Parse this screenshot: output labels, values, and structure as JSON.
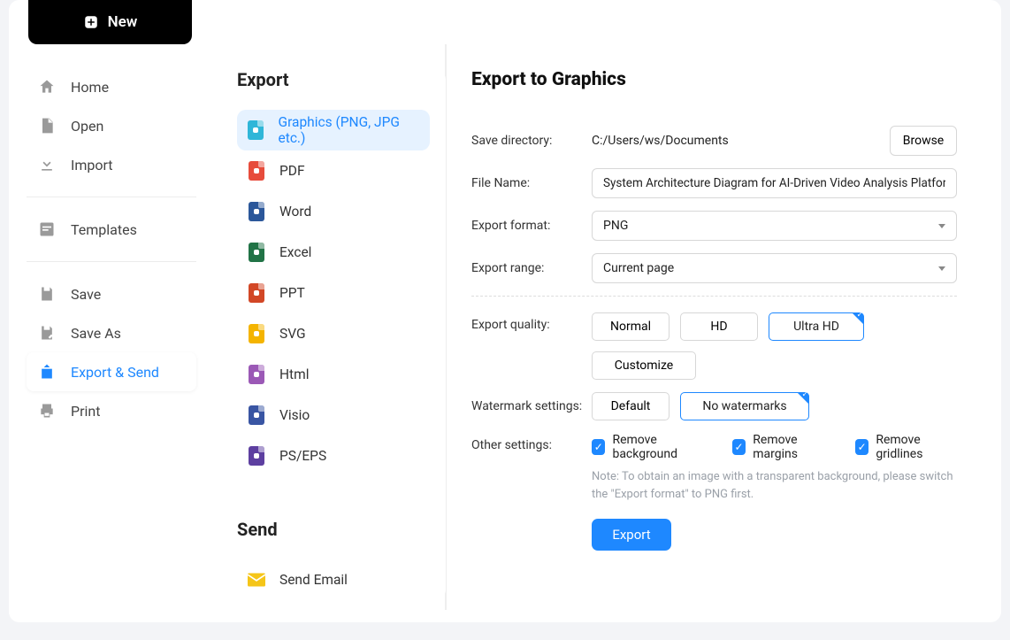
{
  "new_button_label": "New",
  "sidebar": {
    "items": [
      {
        "label": "Home"
      },
      {
        "label": "Open"
      },
      {
        "label": "Import"
      },
      {
        "label": "Templates"
      },
      {
        "label": "Save"
      },
      {
        "label": "Save As"
      },
      {
        "label": "Export & Send"
      },
      {
        "label": "Print"
      }
    ]
  },
  "export_heading": "Export",
  "send_heading": "Send",
  "formats": [
    {
      "label": "Graphics (PNG, JPG etc.)",
      "color": "#2fb6d8"
    },
    {
      "label": "PDF",
      "color": "#e74c3c"
    },
    {
      "label": "Word",
      "color": "#2b579a"
    },
    {
      "label": "Excel",
      "color": "#217346"
    },
    {
      "label": "PPT",
      "color": "#d24726"
    },
    {
      "label": "SVG",
      "color": "#f4b400"
    },
    {
      "label": "Html",
      "color": "#9b59b6"
    },
    {
      "label": "Visio",
      "color": "#3955a3"
    },
    {
      "label": "PS/EPS",
      "color": "#5d3fa0"
    }
  ],
  "send_items": [
    {
      "label": "Send Email",
      "color": "#f5c518"
    }
  ],
  "details": {
    "title": "Export to Graphics",
    "labels": {
      "save_directory": "Save directory:",
      "file_name": "File Name:",
      "export_format": "Export format:",
      "export_range": "Export range:",
      "export_quality": "Export quality:",
      "watermark_settings": "Watermark settings:",
      "other_settings": "Other settings:"
    },
    "save_directory_value": "C:/Users/ws/Documents",
    "browse_label": "Browse",
    "file_name_value": "System Architecture Diagram for AI-Driven Video Analysis Platform",
    "export_format_value": "PNG",
    "export_range_value": "Current page",
    "quality_options": [
      "Normal",
      "HD",
      "Ultra HD"
    ],
    "quality_selected": "Ultra HD",
    "customize_label": "Customize",
    "watermark_options": [
      "Default",
      "No watermarks"
    ],
    "watermark_selected": "No watermarks",
    "checkboxes": {
      "remove_background": "Remove background",
      "remove_margins": "Remove margins",
      "remove_gridlines": "Remove gridlines"
    },
    "note": "Note: To obtain an image with a transparent background, please switch the \"Export format\" to PNG first.",
    "export_button": "Export"
  }
}
